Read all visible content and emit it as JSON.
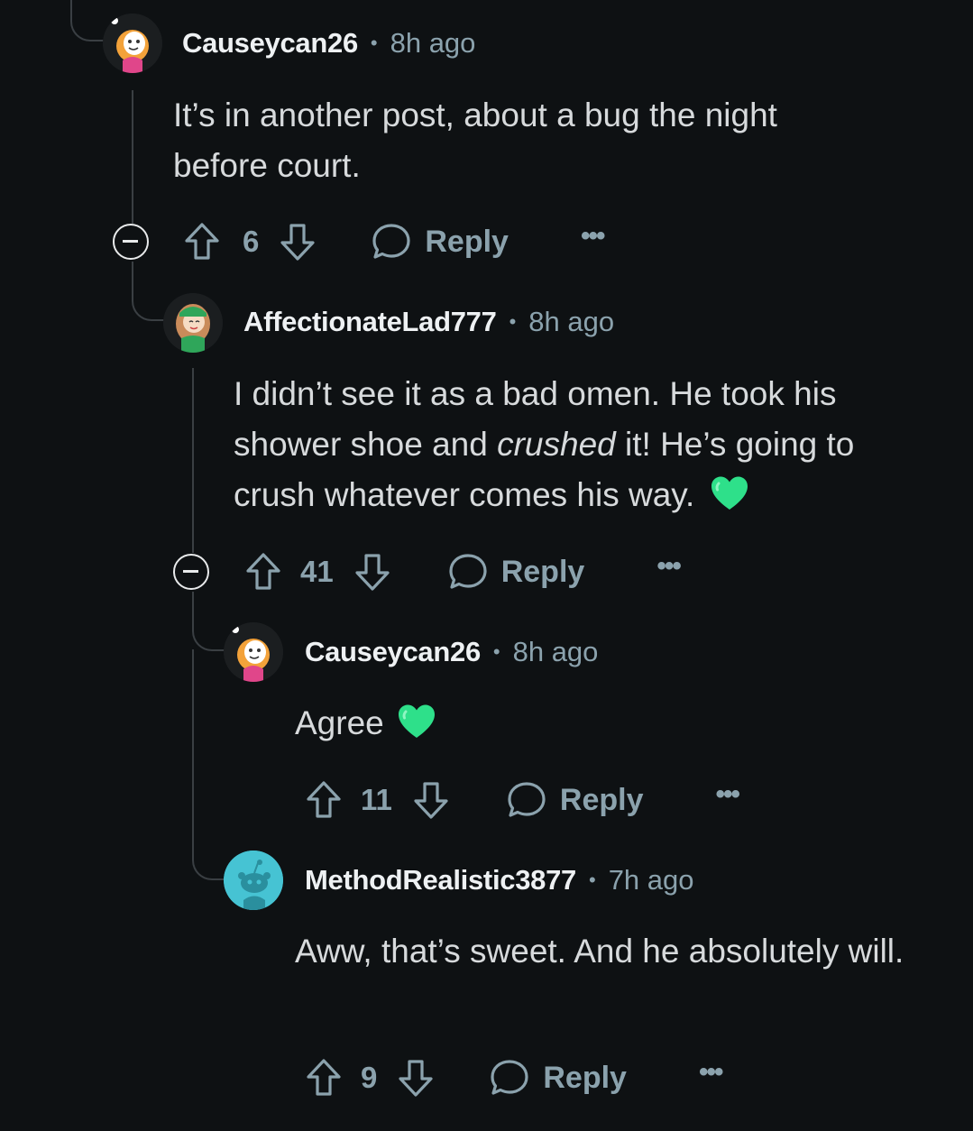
{
  "colors": {
    "background": "#0e1113",
    "thread_line": "#3a3f43",
    "meta_text": "#8ba2ad",
    "heart": "#2ee08a"
  },
  "comments": [
    {
      "username": "Causeycan26",
      "time": "8h ago",
      "text": "It’s in another post, about a bug the night before court.",
      "votes": "6",
      "reply_label": "Reply",
      "more_label": "•••"
    },
    {
      "username": "AffectionateLad777",
      "time": "8h ago",
      "text_parts": {
        "before": "I didn’t see it as a bad omen. He took his shower shoe and ",
        "emphasis": "crushed",
        "after": " it! He’s going to crush whatever comes his way."
      },
      "votes": "41",
      "reply_label": "Reply",
      "more_label": "•••"
    },
    {
      "username": "Causeycan26",
      "time": "8h ago",
      "text": "Agree",
      "votes": "11",
      "reply_label": "Reply",
      "more_label": "•••"
    },
    {
      "username": "MethodRealistic3877",
      "time": "7h ago",
      "text": "Aww, that’s sweet. And he absolutely will.",
      "votes": "9",
      "reply_label": "Reply",
      "more_label": "•••"
    }
  ],
  "dot_separator": "•",
  "icons": [
    "upvote-icon",
    "downvote-icon",
    "reply-bubble-icon",
    "collapse-icon",
    "heart-emoji",
    "snoo-avatar"
  ]
}
